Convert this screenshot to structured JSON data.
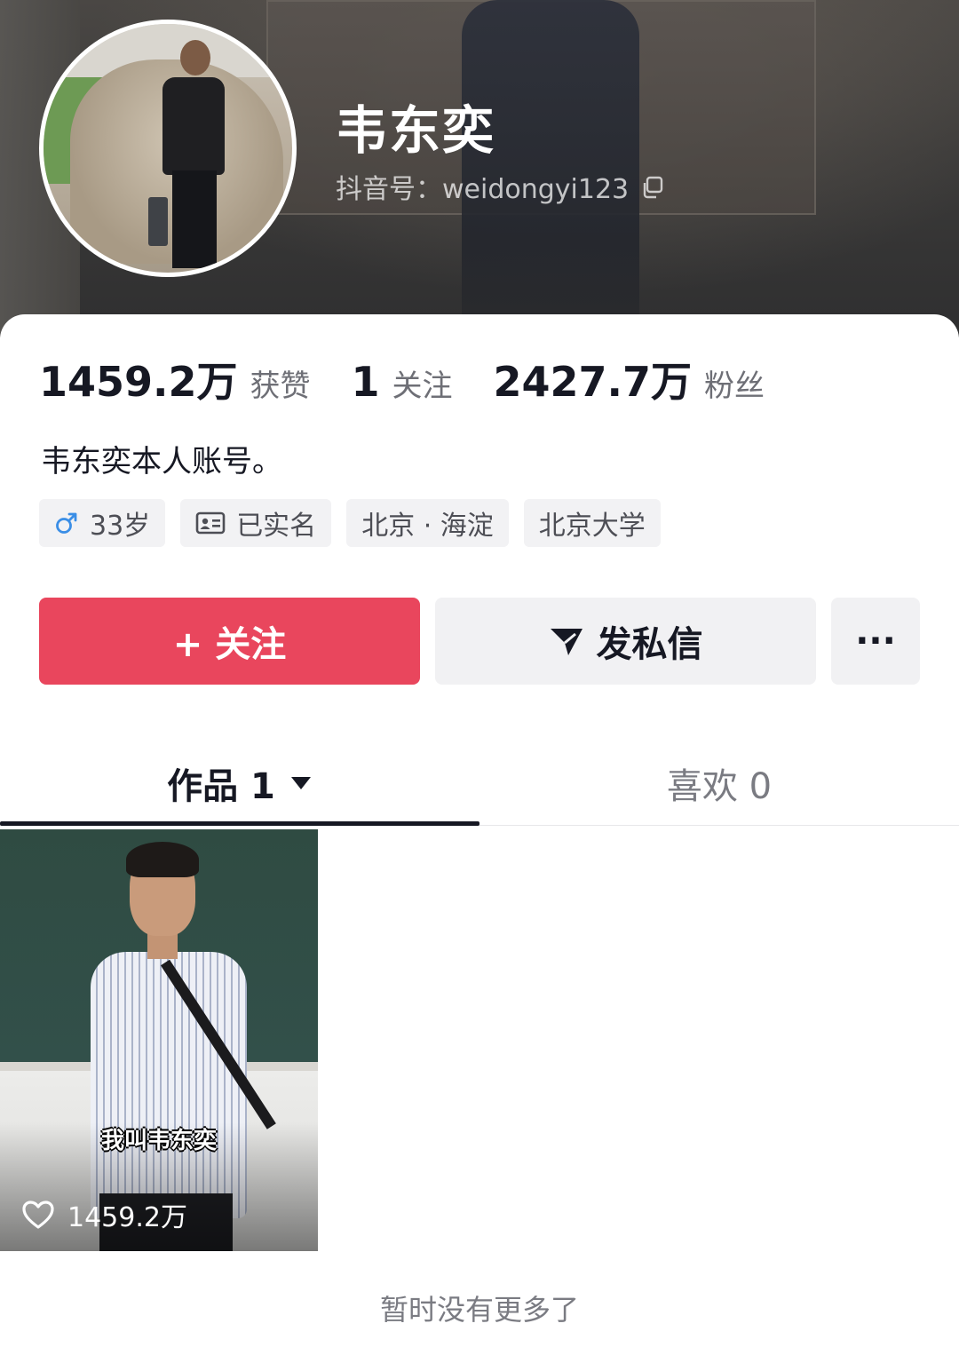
{
  "profile": {
    "name": "韦东奕",
    "douyin_id": "抖音号：weidongyi123",
    "bio": "韦东奕本人账号。"
  },
  "stats": [
    {
      "value": "1459.2万",
      "label": "获赞"
    },
    {
      "value": "1",
      "label": "关注"
    },
    {
      "value": "2427.7万",
      "label": "粉丝"
    }
  ],
  "tags": [
    {
      "icon": "male-icon",
      "label": "33岁"
    },
    {
      "icon": "id-card-icon",
      "label": "已实名"
    },
    {
      "icon": "",
      "label": "北京 · 海淀"
    },
    {
      "icon": "",
      "label": "北京大学"
    }
  ],
  "buttons": {
    "follow": "+ 关注",
    "message": "发私信",
    "more": "···"
  },
  "tabs": [
    {
      "label": "作品 1",
      "active": true
    },
    {
      "label": "喜欢 0",
      "active": false
    }
  ],
  "videos": [
    {
      "caption": "我叫韦东奕",
      "likes": "1459.2万"
    }
  ],
  "end_note": "暂时没有更多了",
  "colors": {
    "follow_button": "#e9465d",
    "text_primary": "#161823",
    "text_secondary": "#6e6f76",
    "tag_bg": "#f2f2f4"
  }
}
